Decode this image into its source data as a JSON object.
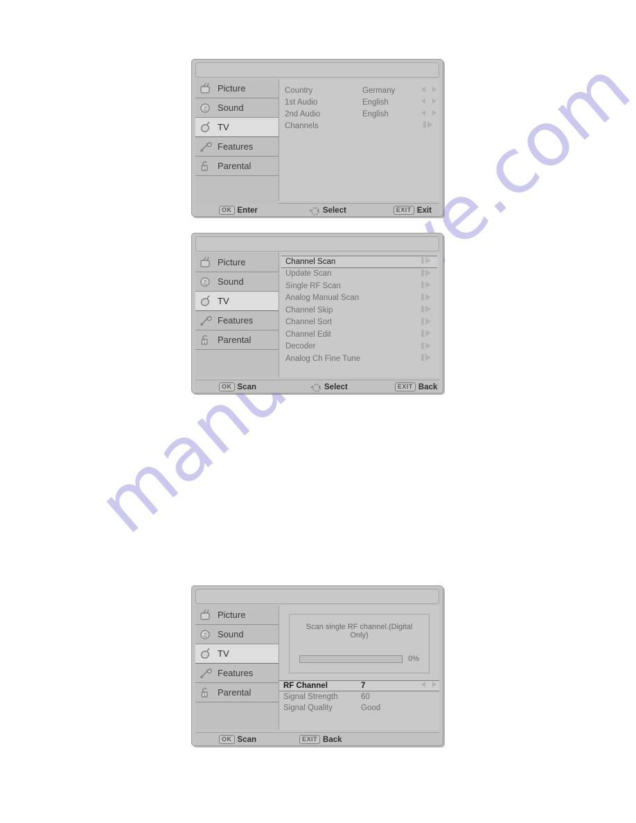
{
  "watermark": {
    "text": "manualshive.com",
    "color": "#c9c8ee"
  },
  "sidebar": {
    "items": [
      {
        "label": "Picture",
        "icon": "tv-set-icon",
        "selected": false
      },
      {
        "label": "Sound",
        "icon": "speaker-note-icon",
        "selected": false
      },
      {
        "label": "TV",
        "icon": "satellite-dish-icon",
        "selected": true
      },
      {
        "label": "Features",
        "icon": "wrench-icon",
        "selected": false
      },
      {
        "label": "Parental",
        "icon": "padlock-icon",
        "selected": false
      }
    ]
  },
  "panels": [
    {
      "id": "tv-settings-panel",
      "title": "",
      "rows": [
        {
          "label": "Country",
          "value": "Germany",
          "arrow": "left-right-arrows"
        },
        {
          "label": "1st Audio",
          "value": "English",
          "arrow": "left-right-arrows"
        },
        {
          "label": "2nd Audio",
          "value": "English",
          "arrow": "left-right-arrows"
        },
        {
          "label": "Channels",
          "value": "",
          "arrow": "enter-submenu-arrow"
        }
      ],
      "footer": [
        {
          "key": "OK",
          "label": "Enter",
          "icon": "key-ok"
        },
        {
          "key": "",
          "label": "Select",
          "icon": "dpad-icon"
        },
        {
          "key": "EXIT",
          "label": "Exit",
          "icon": "key-exit"
        }
      ]
    },
    {
      "id": "channels-menu-panel",
      "title": "",
      "items": [
        {
          "label": "Channel Scan",
          "selected": true,
          "arrow": "enter-submenu-arrow"
        },
        {
          "label": "Update Scan",
          "selected": false,
          "arrow": "enter-submenu-arrow"
        },
        {
          "label": "Single RF Scan",
          "selected": false,
          "arrow": "enter-submenu-arrow"
        },
        {
          "label": "Analog Manual Scan",
          "selected": false,
          "arrow": "enter-submenu-arrow"
        },
        {
          "label": "Channel Skip",
          "selected": false,
          "arrow": "enter-submenu-arrow"
        },
        {
          "label": "Channel Sort",
          "selected": false,
          "arrow": "enter-submenu-arrow"
        },
        {
          "label": "Channel Edit",
          "selected": false,
          "arrow": "enter-submenu-arrow"
        },
        {
          "label": "Decoder",
          "selected": false,
          "arrow": "enter-submenu-arrow"
        },
        {
          "label": "Analog Ch Fine Tune",
          "selected": false,
          "arrow": "enter-submenu-arrow"
        }
      ],
      "footer": [
        {
          "key": "OK",
          "label": "Scan",
          "icon": "key-ok"
        },
        {
          "key": "",
          "label": "Select",
          "icon": "dpad-icon"
        },
        {
          "key": "EXIT",
          "label": "Back",
          "icon": "key-exit"
        }
      ]
    },
    {
      "id": "single-rf-scan-panel",
      "title": "",
      "scan": {
        "description": "Scan single RF channel.(Digital Only)",
        "progress_percent": 0,
        "progress_label": "0%"
      },
      "signal_rows": [
        {
          "label": "RF Channel",
          "value": "7",
          "selected": true,
          "arrow": "left-right-arrows"
        },
        {
          "label": "Signal Strength",
          "value": "60",
          "selected": false,
          "arrow": ""
        },
        {
          "label": "Signal Quality",
          "value": "Good",
          "selected": false,
          "arrow": ""
        }
      ],
      "footer": [
        {
          "key": "OK",
          "label": "Scan",
          "icon": "key-ok"
        },
        {
          "key": "EXIT",
          "label": "Back",
          "icon": "key-exit"
        }
      ]
    }
  ]
}
